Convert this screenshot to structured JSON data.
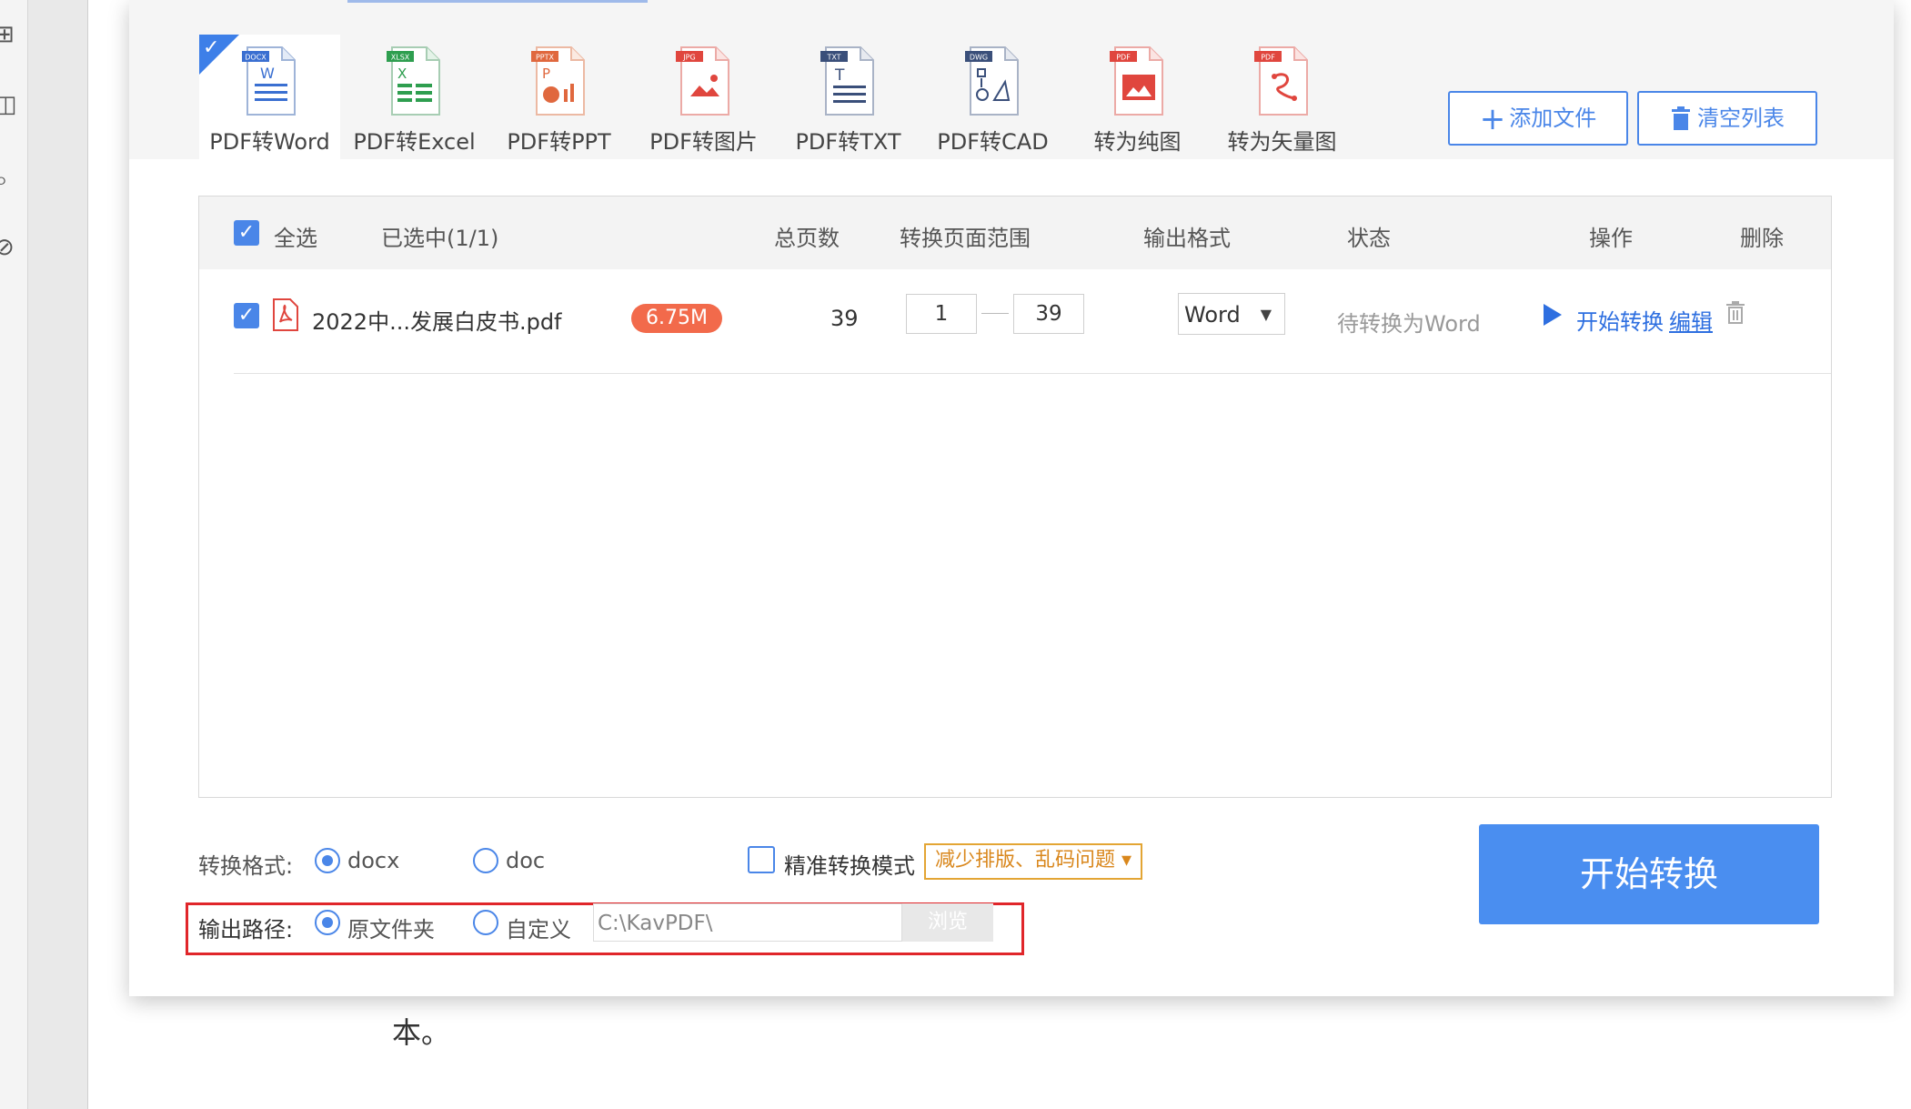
{
  "toolbar": {
    "tools": [
      {
        "label": "PDF转Word",
        "badge": "DOCX",
        "color": "#3a6fd1",
        "active": true
      },
      {
        "label": "PDF转Excel",
        "badge": "XLSX",
        "color": "#2e9e4f",
        "active": false
      },
      {
        "label": "PDF转PPT",
        "badge": "PPTX",
        "color": "#e0683e",
        "active": false
      },
      {
        "label": "PDF转图片",
        "badge": "JPG",
        "color": "#e0463e",
        "active": false
      },
      {
        "label": "PDF转TXT",
        "badge": "TXT",
        "color": "#3a4f7a",
        "active": false
      },
      {
        "label": "PDF转CAD",
        "badge": "DWG",
        "color": "#3a4f7a",
        "active": false
      },
      {
        "label": "转为纯图",
        "badge": "PDF",
        "color": "#e0463e",
        "active": false
      },
      {
        "label": "转为矢量图",
        "badge": "PDF",
        "color": "#e0463e",
        "active": false
      }
    ],
    "add_files_label": "添加文件",
    "clear_list_label": "清空列表"
  },
  "table": {
    "select_all_label": "全选",
    "selected_count": "已选中(1/1)",
    "headers": {
      "total_pages": "总页数",
      "page_range": "转换页面范围",
      "output_format": "输出格式",
      "status": "状态",
      "actions": "操作",
      "delete": "删除"
    },
    "rows": [
      {
        "filename": "2022中...发展白皮书.pdf",
        "size": "6.75M",
        "total_pages": "39",
        "range_from": "1",
        "range_to": "39",
        "format": "Word",
        "status": "待转换为Word",
        "start_label": "开始转换",
        "edit_label": "编辑"
      }
    ]
  },
  "options": {
    "format_label": "转换格式:",
    "format_options": [
      "docx",
      "doc"
    ],
    "format_selected": "docx",
    "precise_mode_label": "精准转换模式",
    "precise_mode_hint": "减少排版、乱码问题",
    "output_path_label": "输出路径:",
    "path_options": [
      "原文件夹",
      "自定义"
    ],
    "path_selected": "原文件夹",
    "path_value": "C:\\KavPDF\\",
    "browse_label": "浏览"
  },
  "start_button_label": "开始转换",
  "background_doc": {
    "visible_text": "本。"
  },
  "colors": {
    "accent": "#4a86e8",
    "primary_button": "#4a8ef0",
    "size_badge": "#f26a4b",
    "highlight_outline": "#e0262a",
    "hint_tag": "#e3a534"
  }
}
